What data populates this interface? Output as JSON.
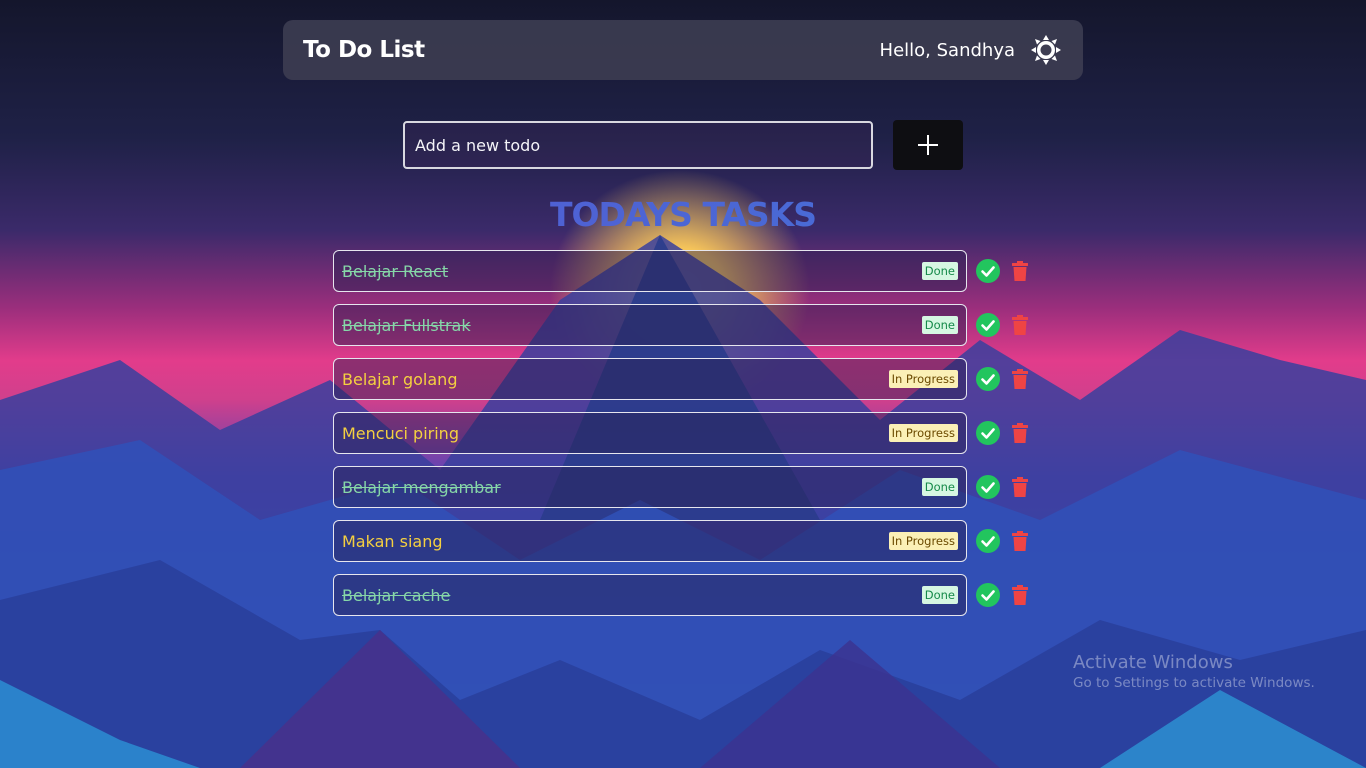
{
  "header": {
    "title": "To Do List",
    "greeting": "Hello, Sandhya",
    "theme_icon": "sun-icon"
  },
  "add_todo": {
    "placeholder": "Add a new todo",
    "value": "",
    "button_icon": "plus-icon"
  },
  "section_title": "TODAYS TASKS",
  "tasks": [
    {
      "text": "Belajar React",
      "status": "Done"
    },
    {
      "text": "Belajar Fullstrak",
      "status": "Done"
    },
    {
      "text": "Belajar golang",
      "status": "In Progress"
    },
    {
      "text": "Mencuci piring",
      "status": "In Progress"
    },
    {
      "text": "Belajar mengambar",
      "status": "Done"
    },
    {
      "text": "Makan siang",
      "status": "In Progress"
    },
    {
      "text": "Belajar cache",
      "status": "Done"
    }
  ],
  "watermark": {
    "title": "Activate Windows",
    "subtitle": "Go to Settings to activate Windows."
  },
  "colors": {
    "done_text": "#86d6a8",
    "progress_text": "#f5d040",
    "check": "#22c55e",
    "trash": "#ef4444"
  }
}
